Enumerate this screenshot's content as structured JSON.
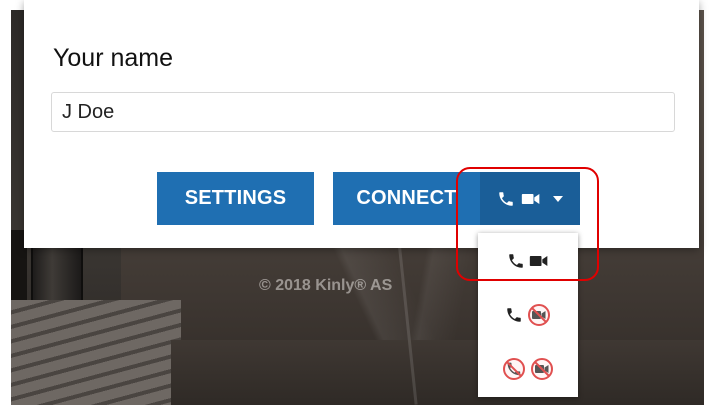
{
  "form": {
    "name_label": "Your name",
    "name_value": "J Doe"
  },
  "buttons": {
    "settings_label": "SETTINGS",
    "connect_label": "CONNECT"
  },
  "media_options": [
    {
      "audio": true,
      "video": true
    },
    {
      "audio": true,
      "video": false
    },
    {
      "audio": false,
      "video": false
    }
  ],
  "footer": {
    "copyright": "© 2018 Kinly® AS"
  },
  "colors": {
    "primary_button": "#1f6fb2",
    "media_button": "#1a5e98",
    "disabled_icon": "#e05050",
    "highlight": "#e00000"
  },
  "icons": {
    "audio": "phone-icon",
    "video": "video-camera-icon",
    "dropdown": "caret-down-icon",
    "audio_off": "phone-off-icon",
    "video_off": "video-off-icon"
  }
}
